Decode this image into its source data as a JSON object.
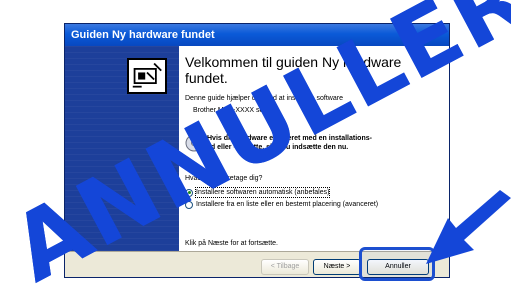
{
  "window": {
    "title": "Guiden Ny hardware fundet"
  },
  "wizard": {
    "heading": "Velkommen til guiden Ny hardware fundet.",
    "intro": "Denne guide hjælper dig med at installere software",
    "device": "Brother MFC-XXXX series",
    "cd_notice": "Hvis din hardware er leveret med en installations-cd eller -diskette, skal du indsætte den nu.",
    "question": "Hvad vil du foretage dig?",
    "options": [
      {
        "label": "Installere softwaren automatisk (anbefales)",
        "selected": true
      },
      {
        "label": "Installere fra en liste eller en bestemt placering (avanceret)",
        "selected": false
      }
    ],
    "next_hint": "Klik på Næste for at fortsætte."
  },
  "buttons": {
    "back": "< Tilbage",
    "next": "Næste >",
    "cancel": "Annuller"
  },
  "overlay": {
    "text": "ANNULLER",
    "color": "#1446d8"
  }
}
